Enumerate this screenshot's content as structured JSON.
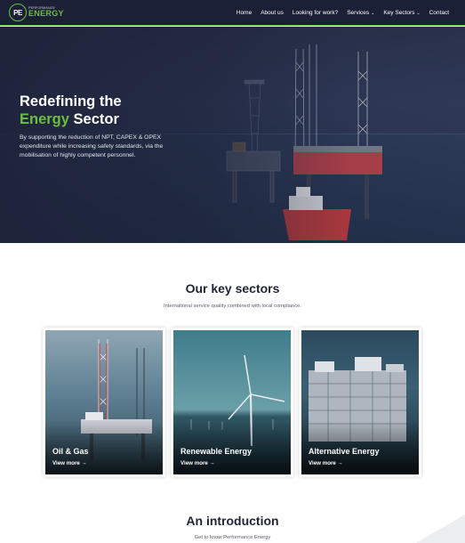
{
  "brand": {
    "mark": "PE",
    "small": "PERFORMANCE",
    "big": "ENERGY"
  },
  "nav": {
    "items": [
      {
        "label": "Home",
        "dropdown": false
      },
      {
        "label": "About us",
        "dropdown": false
      },
      {
        "label": "Looking for work?",
        "dropdown": false
      },
      {
        "label": "Services",
        "dropdown": true
      },
      {
        "label": "Key Sectors",
        "dropdown": true
      },
      {
        "label": "Contact",
        "dropdown": false
      }
    ],
    "caret": "⌄"
  },
  "hero": {
    "title_line1": "Redefining the",
    "title_green": "Energy",
    "title_rest": " Sector",
    "text": "By supporting the reduction of NPT, CAPEX & OPEX expenditure while increasing safety standards, via the mobilisation of highly competent personnel."
  },
  "sectors": {
    "title": "Our key sectors",
    "subtitle": "International service quality combined with local compliance.",
    "cards": [
      {
        "label": "Oil & Gas",
        "more": "View more  →"
      },
      {
        "label": "Renewable Energy",
        "more": "View more  →"
      },
      {
        "label": "Alternative Energy",
        "more": "View more  →"
      }
    ]
  },
  "intro": {
    "title": "An introduction",
    "subtitle": "Get to know Performance Energy"
  },
  "colors": {
    "navy": "#1c2037",
    "green": "#6cbf3f"
  }
}
